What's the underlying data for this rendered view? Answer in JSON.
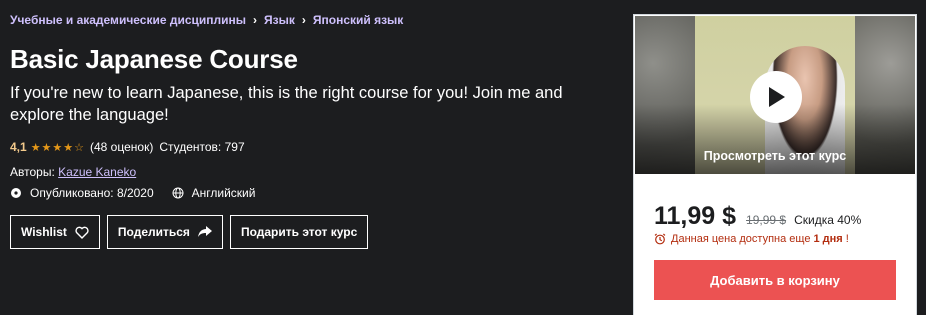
{
  "breadcrumb": {
    "items": [
      "Учебные и академические дисциплины",
      "Язык",
      "Японский язык"
    ],
    "separator": "›"
  },
  "course": {
    "title": "Basic Japanese Course",
    "subtitle": "If you're new to learn Japanese, this is the right course for you! Join me and explore the language!",
    "rating": "4,1",
    "rating_value": 4.1,
    "stars": "★★★★☆",
    "reviews": "(48 оценок)",
    "students": "Студентов: 797",
    "authors_label": "Авторы:",
    "author": "Kazue Kaneko",
    "published": "Опубликовано: 8/2020",
    "language": "Английский"
  },
  "actions": {
    "wishlist": "Wishlist",
    "share": "Поделиться",
    "gift": "Подарить этот курс"
  },
  "card": {
    "preview_label": "Просмотреть этот курс",
    "price": "11,99 $",
    "old_price": "19,99 $",
    "discount": "Скидка 40%",
    "timer_prefix": "Данная цена доступна еще",
    "timer_bold": "1 дня",
    "timer_suffix": "!",
    "add_to_cart": "Добавить в корзину"
  },
  "colors": {
    "background": "#1c1d1f",
    "breadcrumb": "#cec0fc",
    "rating": "#f3ca8c",
    "stars": "#e59819",
    "cart": "#ec5252",
    "timer": "#b32d0f"
  }
}
